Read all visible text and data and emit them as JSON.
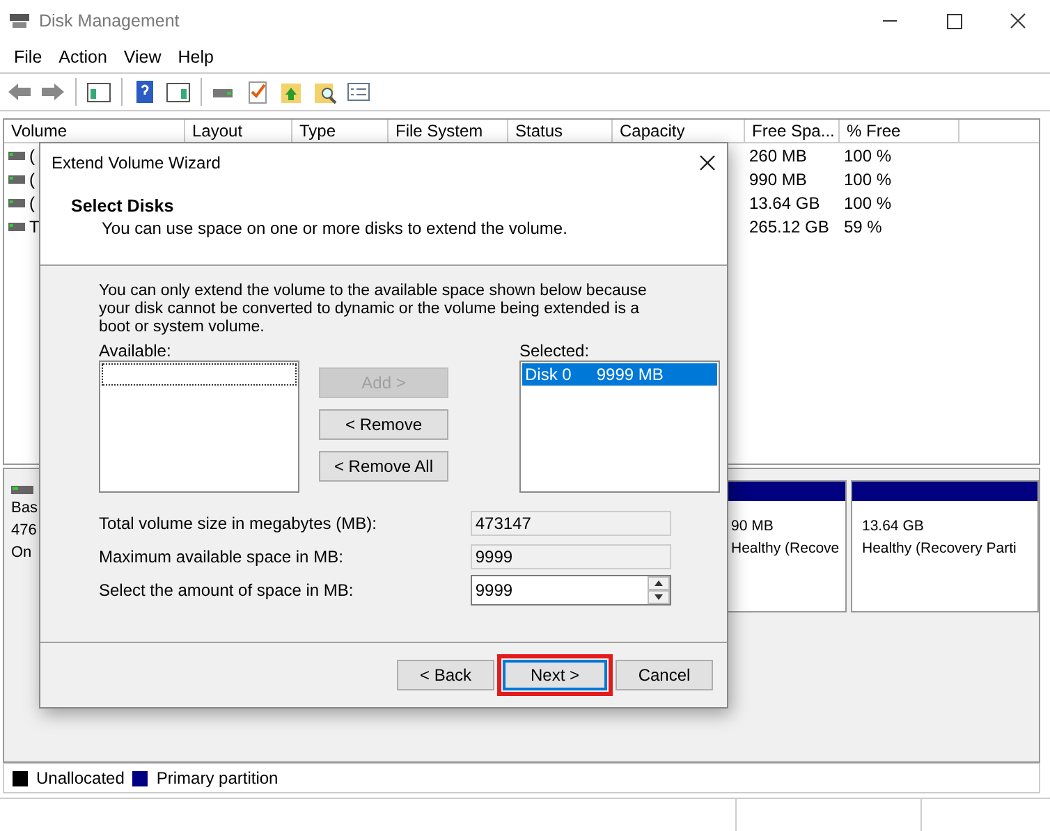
{
  "window": {
    "title": "Disk Management"
  },
  "menu": [
    "File",
    "Action",
    "View",
    "Help"
  ],
  "volume_table": {
    "columns": [
      "Volume",
      "Layout",
      "Type",
      "File System",
      "Status",
      "Capacity",
      "Free Spa...",
      "% Free"
    ],
    "rows": [
      {
        "volume": "(",
        "free_space": "260 MB",
        "percent_free": "100 %"
      },
      {
        "volume": "(",
        "free_space": "990 MB",
        "percent_free": "100 %"
      },
      {
        "volume": "(",
        "free_space": "13.64 GB",
        "percent_free": "100 %"
      },
      {
        "volume": "T",
        "free_space": "265.12 GB",
        "percent_free": "59 %"
      }
    ]
  },
  "disk_pane": {
    "disk_label": [
      "Bas",
      "476",
      "On"
    ],
    "partitions": [
      {
        "size": "90 MB",
        "status": "Healthy (Recove"
      },
      {
        "size": "13.64 GB",
        "status": "Healthy (Recovery Parti"
      }
    ]
  },
  "legend": [
    {
      "label": "Unallocated",
      "color": "#000000"
    },
    {
      "label": "Primary partition",
      "color": "#000080"
    }
  ],
  "dialog": {
    "title": "Extend Volume Wizard",
    "heading": "Select Disks",
    "subtitle": "You can use space on one or more disks to extend the volume.",
    "note": "You can only extend the volume to the available space shown below because your disk cannot be converted to dynamic or the volume being extended is a boot or system volume.",
    "available_label": "Available:",
    "selected_label": "Selected:",
    "selected_items": [
      {
        "disk": "Disk 0",
        "size": "9999 MB",
        "selected": true
      }
    ],
    "move_buttons": [
      {
        "label": "Add >",
        "disabled": true
      },
      {
        "label": "< Remove",
        "disabled": false
      },
      {
        "label": "< Remove All",
        "disabled": false
      }
    ],
    "fields": [
      {
        "label": "Total volume size in megabytes (MB):",
        "value": "473147",
        "kind": "readonly"
      },
      {
        "label": "Maximum available space in MB:",
        "value": "9999",
        "kind": "readonly"
      },
      {
        "label": "Select the amount of space in MB:",
        "value": "9999",
        "kind": "spin"
      }
    ],
    "footer_buttons": [
      {
        "label": "< Back",
        "highlighted": false
      },
      {
        "label": "Next >",
        "highlighted": true
      },
      {
        "label": "Cancel",
        "highlighted": false
      }
    ]
  }
}
